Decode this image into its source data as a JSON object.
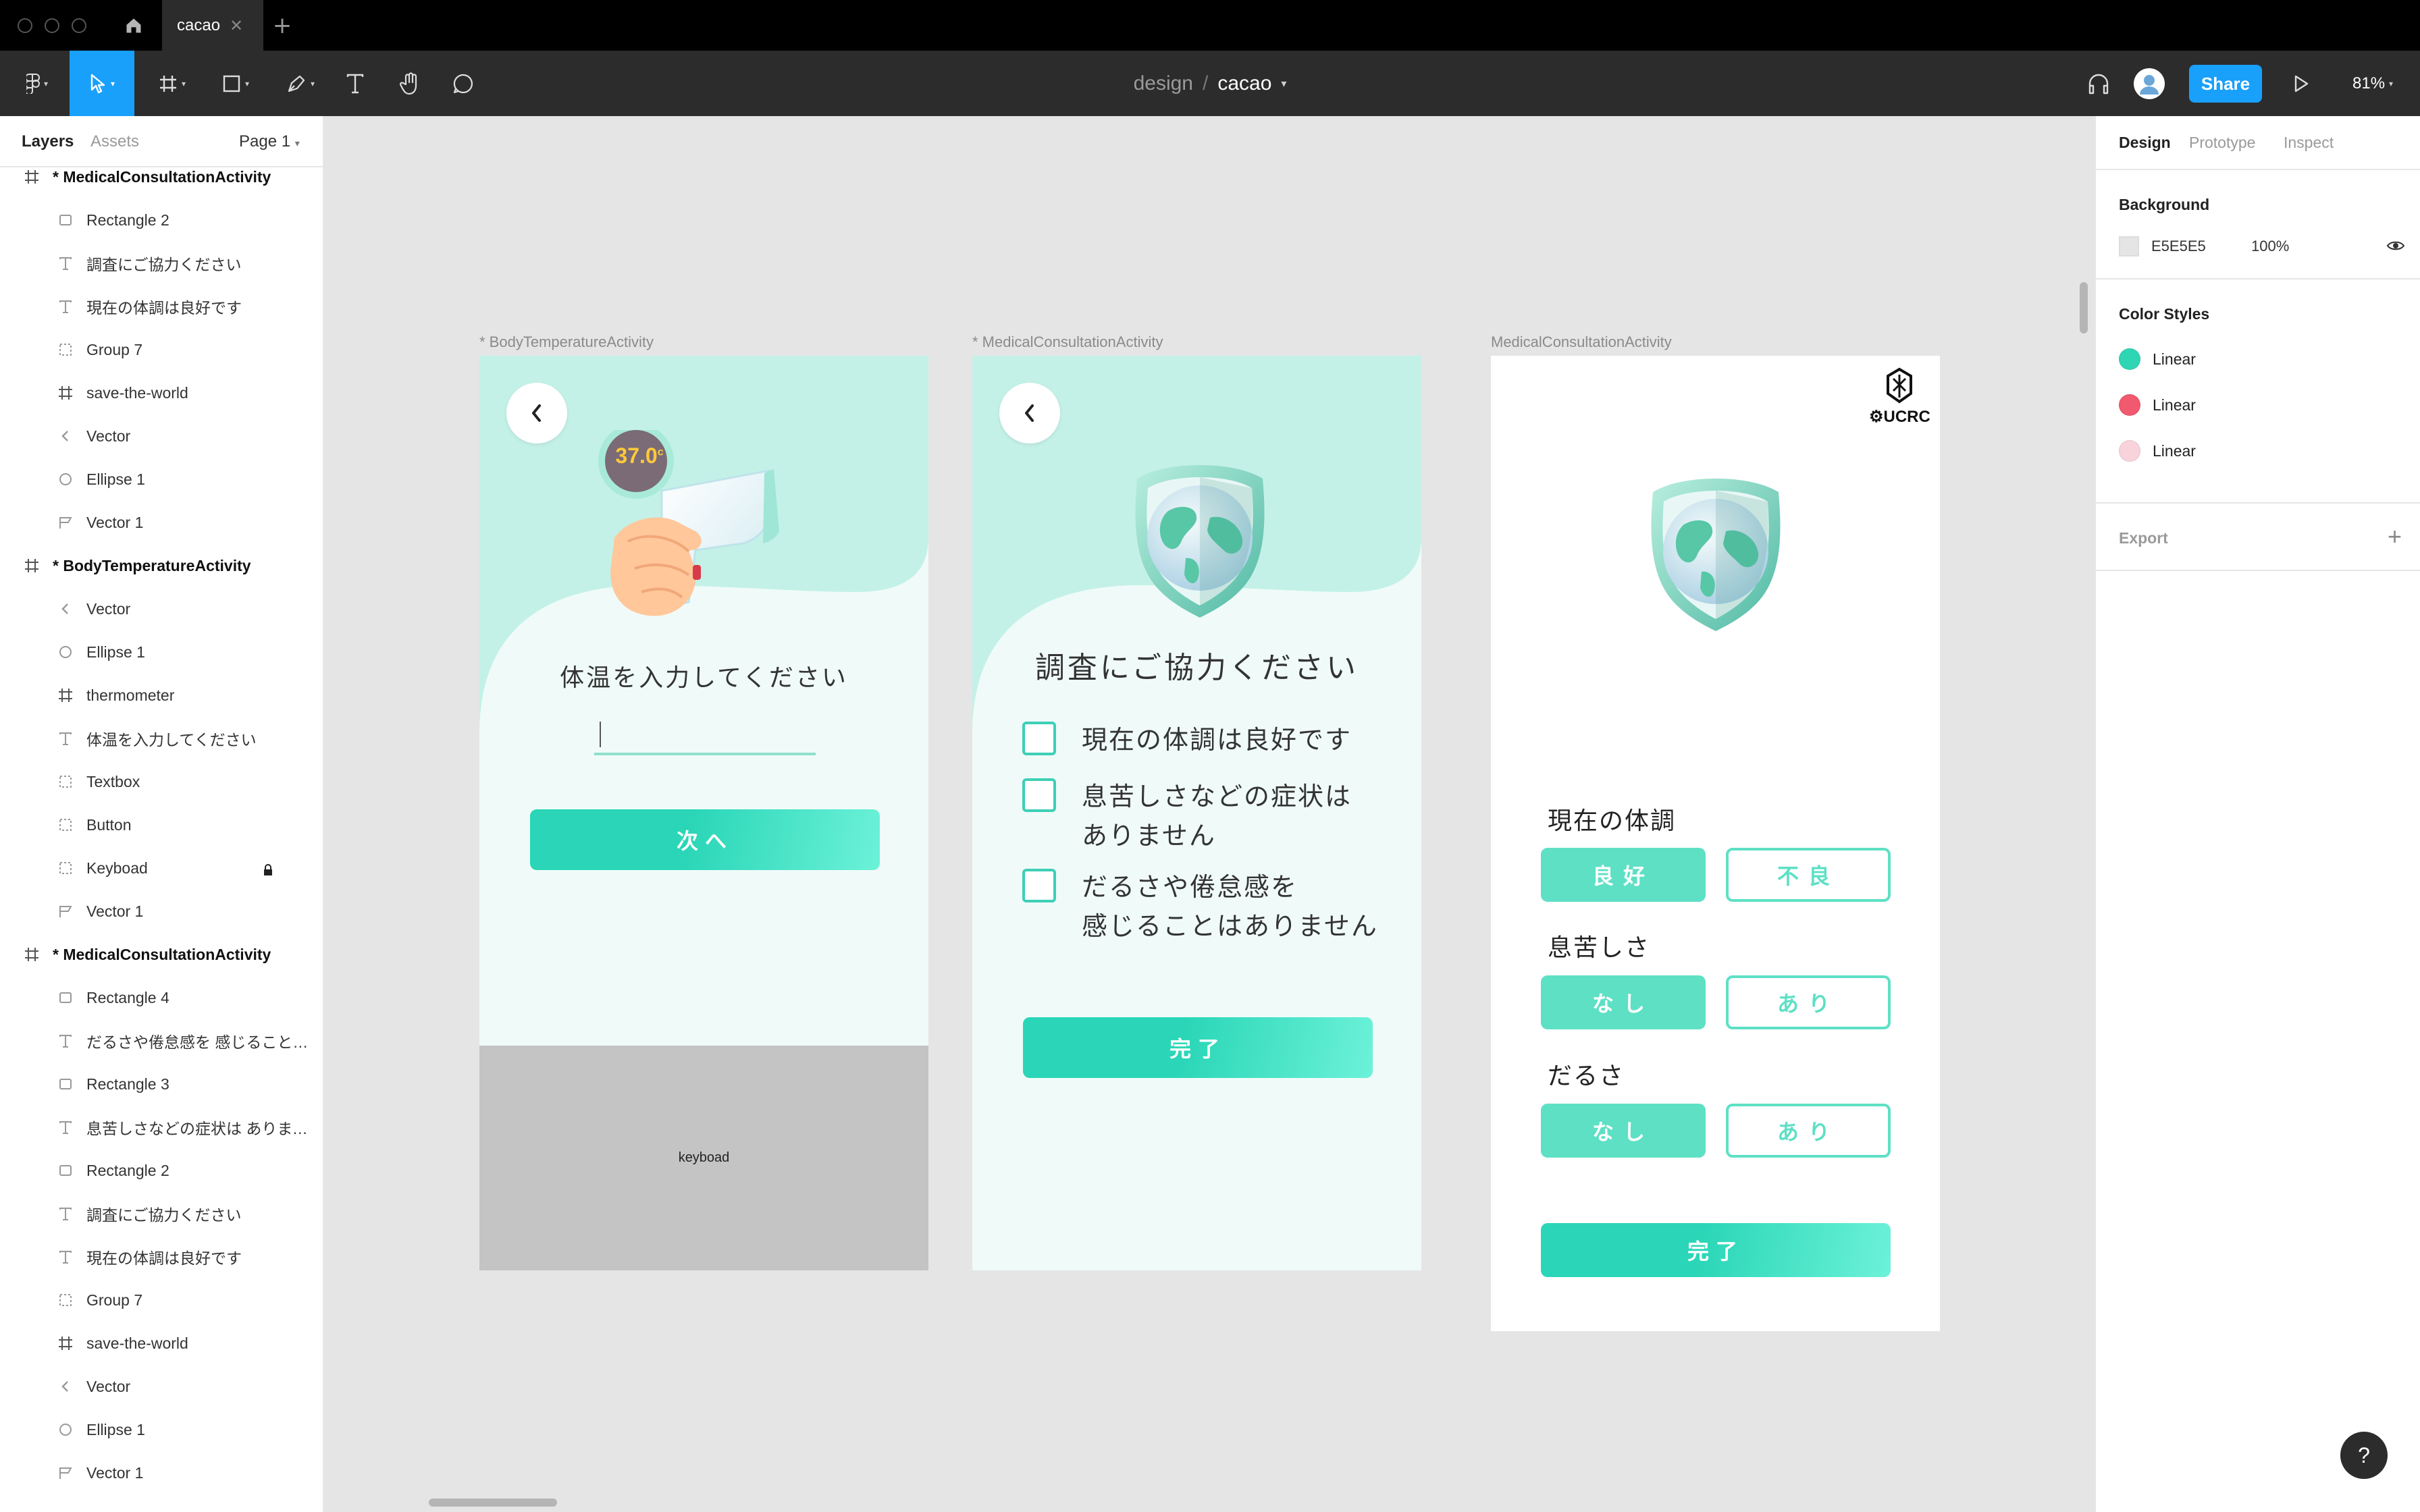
{
  "tab": {
    "title": "cacao"
  },
  "breadcrumb": {
    "project": "design",
    "separator": "/",
    "file": "cacao"
  },
  "toolbar": {
    "share_label": "Share",
    "zoom": "81%"
  },
  "left_panel": {
    "tabs": [
      "Layers",
      "Assets"
    ],
    "page": "Page 1",
    "layers": [
      {
        "name": "* MedicalConsultationActivity",
        "icon": "frame-icon",
        "level": 0
      },
      {
        "name": "Rectangle 2",
        "icon": "rectangle-icon",
        "level": 1
      },
      {
        "name": "調査にご協力ください",
        "icon": "text-icon",
        "level": 1
      },
      {
        "name": "現在の体調は良好です",
        "icon": "text-icon",
        "level": 1
      },
      {
        "name": "Group 7",
        "icon": "group-icon",
        "level": 1
      },
      {
        "name": "save-the-world",
        "icon": "frame-icon",
        "level": 1
      },
      {
        "name": "Vector",
        "icon": "vector-chevron-icon",
        "level": 1
      },
      {
        "name": "Ellipse 1",
        "icon": "ellipse-icon",
        "level": 1
      },
      {
        "name": "Vector 1",
        "icon": "vector-path-icon",
        "level": 1
      },
      {
        "name": "* BodyTemperatureActivity",
        "icon": "frame-icon",
        "level": 0
      },
      {
        "name": "Vector",
        "icon": "vector-chevron-icon",
        "level": 1
      },
      {
        "name": "Ellipse 1",
        "icon": "ellipse-icon",
        "level": 1
      },
      {
        "name": "thermometer",
        "icon": "frame-icon",
        "level": 1
      },
      {
        "name": "体温を入力してください",
        "icon": "text-icon",
        "level": 1
      },
      {
        "name": "Textbox",
        "icon": "group-icon",
        "level": 1
      },
      {
        "name": "Button",
        "icon": "group-icon",
        "level": 1
      },
      {
        "name": "Keyboad",
        "icon": "group-icon",
        "level": 1,
        "locked": true
      },
      {
        "name": "Vector 1",
        "icon": "vector-path-icon",
        "level": 1
      },
      {
        "name": "* MedicalConsultationActivity",
        "icon": "frame-icon",
        "level": 0
      },
      {
        "name": "Rectangle 4",
        "icon": "rectangle-icon",
        "level": 1
      },
      {
        "name": "だるさや倦怠感を 感じることは...",
        "icon": "text-icon",
        "level": 1
      },
      {
        "name": "Rectangle 3",
        "icon": "rectangle-icon",
        "level": 1
      },
      {
        "name": "息苦しさなどの症状は ありませ...",
        "icon": "text-icon",
        "level": 1
      },
      {
        "name": "Rectangle 2",
        "icon": "rectangle-icon",
        "level": 1
      },
      {
        "name": "調査にご協力ください",
        "icon": "text-icon",
        "level": 1
      },
      {
        "name": "現在の体調は良好です",
        "icon": "text-icon",
        "level": 1
      },
      {
        "name": "Group 7",
        "icon": "group-icon",
        "level": 1
      },
      {
        "name": "save-the-world",
        "icon": "frame-icon",
        "level": 1
      },
      {
        "name": "Vector",
        "icon": "vector-chevron-icon",
        "level": 1
      },
      {
        "name": "Ellipse 1",
        "icon": "ellipse-icon",
        "level": 1
      },
      {
        "name": "Vector 1",
        "icon": "vector-path-icon",
        "level": 1
      }
    ]
  },
  "right_panel": {
    "tabs": [
      "Design",
      "Prototype",
      "Inspect"
    ],
    "background_title": "Background",
    "background_hex": "E5E5E5",
    "background_color": "#E5E5E5",
    "background_opacity": "100%",
    "color_styles_title": "Color Styles",
    "color_styles": [
      {
        "name": "Linear",
        "color": "#2fd6b4"
      },
      {
        "name": "Linear",
        "color": "#f0596e"
      },
      {
        "name": "Linear",
        "color": "#f9d3dc"
      }
    ],
    "export_title": "Export"
  },
  "canvas": {
    "frame1": {
      "label": "* BodyTemperatureActivity",
      "temperature": "37.0",
      "temperature_unit": "c",
      "prompt": "体温を入力してください",
      "next_button": "次へ",
      "keyboard_label": "keyboad"
    },
    "frame2": {
      "label": "* MedicalConsultationActivity",
      "title": "調査にご協力ください",
      "checks": [
        {
          "line1": "現在の体調は良好です",
          "line2": ""
        },
        {
          "line1": "息苦しさなどの症状は",
          "line2": "ありません"
        },
        {
          "line1": "だるさや倦怠感を",
          "line2": "感じることはありません"
        }
      ],
      "done_button": "完了"
    },
    "frame3": {
      "label": "MedicalConsultationActivity",
      "logo_text": "UCRC",
      "questions": [
        {
          "label": "現在の体調",
          "option_a": "良好",
          "option_b": "不良"
        },
        {
          "label": "息苦しさ",
          "option_a": "なし",
          "option_b": "あり"
        },
        {
          "label": "だるさ",
          "option_a": "なし",
          "option_b": "あり"
        }
      ],
      "done_button": "完了"
    }
  },
  "colors": {
    "accent": "#2ad6b7",
    "mint_bg": "#f0fbf9",
    "mint_top": "#c4f1e7",
    "figma_blue": "#18a0fb"
  }
}
